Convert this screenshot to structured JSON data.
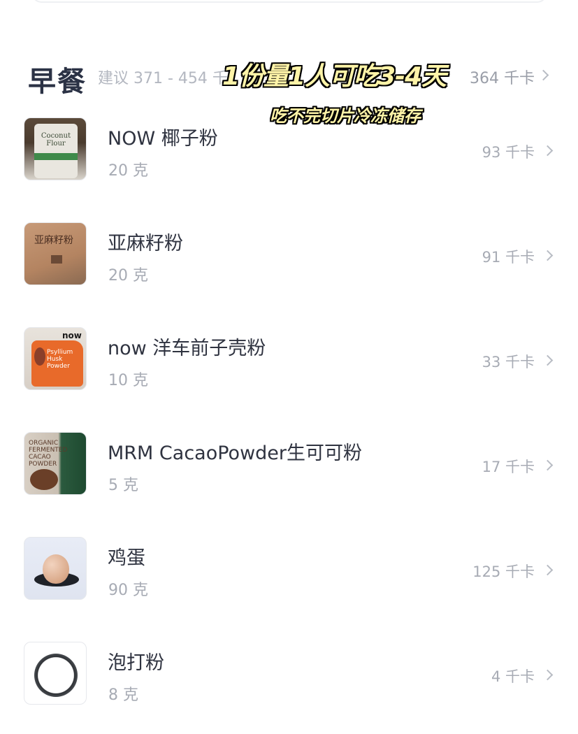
{
  "section": {
    "title": "早餐",
    "suggest": "建议 371 - 454 千",
    "total": "364 千卡"
  },
  "overlay": {
    "title": "1份量1人可吃3-4天",
    "subtitle": "吃不完切片冷冻储存"
  },
  "thumbnail_text": {
    "coconut": "Coconut Flour",
    "flax": "亚麻籽粉",
    "psyllium_logo": "now",
    "psyllium": "Psyllium Husk Powder",
    "cacao": "ORGANIC FERMENTED CACAO POWDER"
  },
  "foods": [
    {
      "name": "NOW 椰子粉",
      "amount": "20 克",
      "kcal": "93 千卡",
      "thumb_icon": "coconut-flour-bag"
    },
    {
      "name": "亚麻籽粉",
      "amount": "20 克",
      "kcal": "91 千卡",
      "thumb_icon": "flaxseed-powder-bag"
    },
    {
      "name": "now 洋车前子壳粉",
      "amount": "10 克",
      "kcal": "33 千卡",
      "thumb_icon": "psyllium-husk-bag"
    },
    {
      "name": "MRM CacaoPowder生可可粉",
      "amount": "5 克",
      "kcal": "17 千卡",
      "thumb_icon": "cacao-powder-bag"
    },
    {
      "name": "鸡蛋",
      "amount": "90 克",
      "kcal": "125 千卡",
      "thumb_icon": "egg"
    },
    {
      "name": "泡打粉",
      "amount": "8 克",
      "kcal": "4 千卡",
      "thumb_icon": "baking-powder-tin"
    }
  ]
}
